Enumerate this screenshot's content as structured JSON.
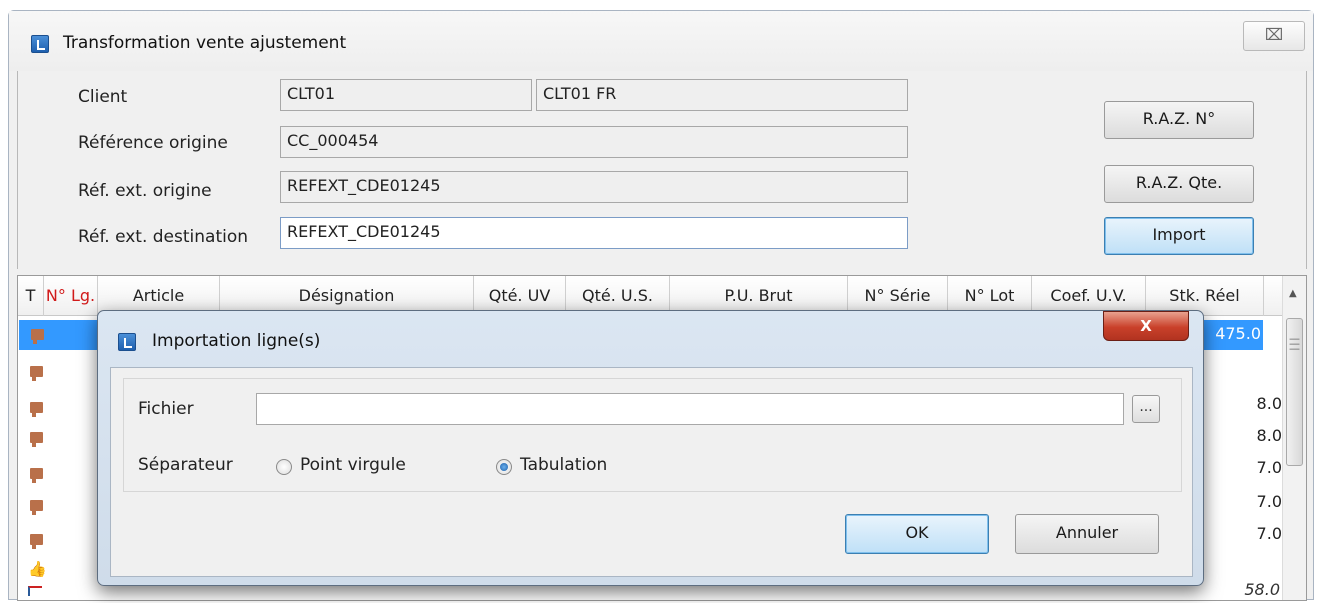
{
  "window": {
    "title": "Transformation vente ajustement",
    "close_symbol": "⌧"
  },
  "header": {
    "client_label": "Client",
    "client_code": "CLT01",
    "client_name": "CLT01 FR",
    "ref_origine_label": "Référence origine",
    "ref_origine_value": "CC_000454",
    "ref_ext_origine_label": "Réf. ext. origine",
    "ref_ext_origine_value": "REFEXT_CDE01245",
    "ref_ext_dest_label": "Réf. ext. destination",
    "ref_ext_dest_value": "REFEXT_CDE01245"
  },
  "buttons": {
    "raz_no": "R.A.Z. N°",
    "raz_qte": "R.A.Z. Qte.",
    "import": "Import"
  },
  "grid": {
    "columns": [
      "T",
      "N° Lg.",
      "Article",
      "Désignation",
      "Qté. UV",
      "Qté. U.S.",
      "P.U. Brut",
      "N° Série",
      "N° Lot",
      "Coef. U.V.",
      "Stk. Réel"
    ],
    "stk_values": [
      "475.0",
      "8.0",
      "8.0",
      "7.0",
      "7.0",
      "7.0",
      "58.0"
    ]
  },
  "dialog": {
    "title": "Importation ligne(s)",
    "close_symbol": "X",
    "fichier_label": "Fichier",
    "fichier_value": "",
    "browse_label": "...",
    "separateur_label": "Séparateur",
    "option_point_virgule": "Point virgule",
    "option_tabulation": "Tabulation",
    "selected_separator": "Tabulation",
    "ok_label": "OK",
    "cancel_label": "Annuler"
  },
  "colors": {
    "selection": "#3399ff",
    "focus_button": "#bfe0f7",
    "close_red": "#c9402a"
  }
}
